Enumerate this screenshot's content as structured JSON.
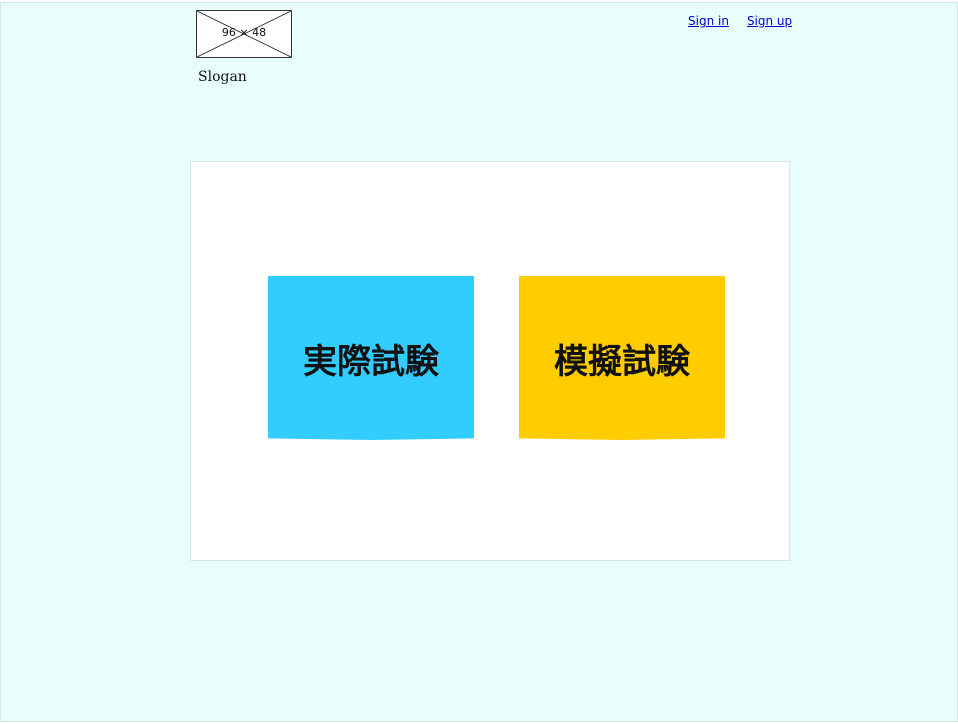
{
  "header": {
    "logo_label": "96 × 48",
    "slogan": "Slogan",
    "nav": {
      "sign_in": "Sign in",
      "sign_up": "Sign up"
    }
  },
  "main": {
    "tiles": [
      {
        "label": "実際試験",
        "color": "#33ccff"
      },
      {
        "label": "模擬試験",
        "color": "#ffcc00"
      }
    ]
  },
  "colors": {
    "page_background": "#e8fefd",
    "panel_background": "#ffffff",
    "link": "#0000cc"
  }
}
